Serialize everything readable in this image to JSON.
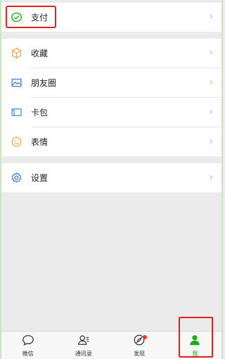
{
  "menu": {
    "pay": {
      "label": "支付",
      "icon": "pay-icon",
      "color": "#1aad19"
    },
    "items": [
      {
        "label": "收藏",
        "icon": "favorites-icon",
        "color": "#f3a73b"
      },
      {
        "label": "朋友圈",
        "icon": "moments-icon",
        "color": "#3b7de0"
      },
      {
        "label": "卡包",
        "icon": "card-wallet-icon",
        "color": "#3b8de0"
      },
      {
        "label": "表情",
        "icon": "sticker-icon",
        "color": "#f3b33b"
      }
    ],
    "settings": {
      "label": "设置",
      "icon": "settings-icon",
      "color": "#3b7de0"
    },
    "chevron": "›"
  },
  "tabs": [
    {
      "label": "微信",
      "icon": "chats-icon"
    },
    {
      "label": "通讯录",
      "icon": "contacts-icon"
    },
    {
      "label": "发现",
      "icon": "discover-icon",
      "badge": true
    },
    {
      "label": "我",
      "icon": "me-icon",
      "active": true,
      "color": "#1aad19"
    }
  ]
}
